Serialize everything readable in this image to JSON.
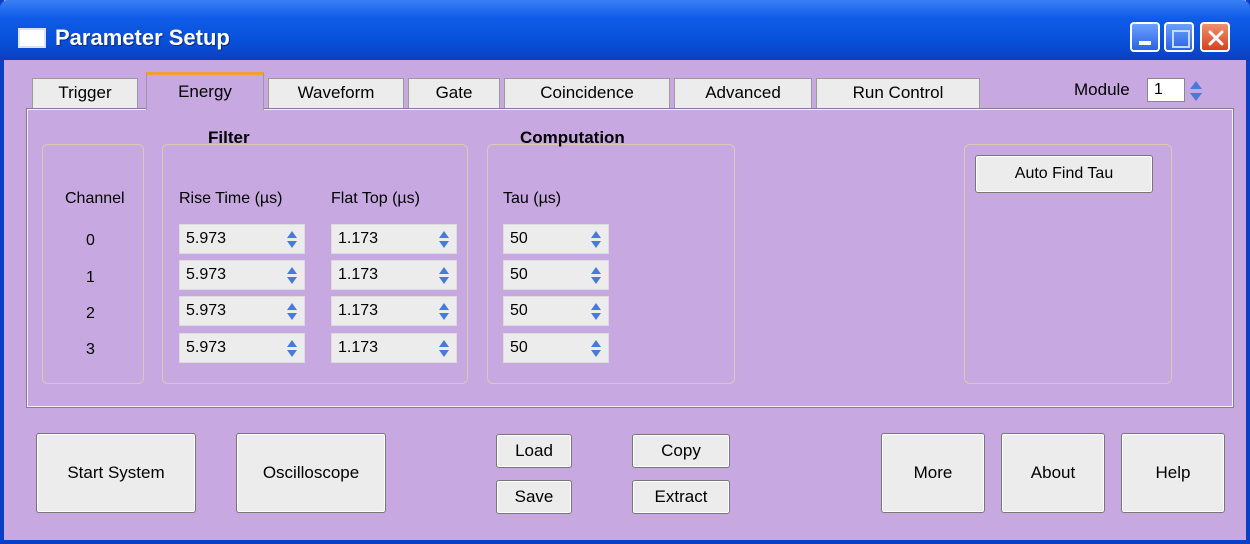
{
  "window": {
    "title": "Parameter Setup"
  },
  "tabs": [
    "Trigger",
    "Energy",
    "Waveform",
    "Gate",
    "Coincidence",
    "Advanced",
    "Run Control"
  ],
  "active_tab": "Energy",
  "module": {
    "label": "Module",
    "value": "1"
  },
  "energy": {
    "channel_header": "Channel",
    "channels": [
      "0",
      "1",
      "2",
      "3"
    ],
    "filter": {
      "title": "Filter",
      "rise_time_label": "Rise Time (µs)",
      "flat_top_label": "Flat Top (µs)",
      "rise_time": [
        "5.973",
        "5.973",
        "5.973",
        "5.973"
      ],
      "flat_top": [
        "1.173",
        "1.173",
        "1.173",
        "1.173"
      ]
    },
    "computation": {
      "title": "Computation",
      "tau_label": "Tau (µs)",
      "tau": [
        "50",
        "50",
        "50",
        "50"
      ]
    },
    "auto_find_tau": "Auto Find Tau"
  },
  "buttons": {
    "start_system": "Start System",
    "oscilloscope": "Oscilloscope",
    "load": "Load",
    "save": "Save",
    "copy": "Copy",
    "extract": "Extract",
    "more": "More",
    "about": "About",
    "help": "Help"
  },
  "colors": {
    "background": "#c8a8e0",
    "titlebar": "#0f5ce8",
    "active_tab_accent": "#f0a030"
  }
}
